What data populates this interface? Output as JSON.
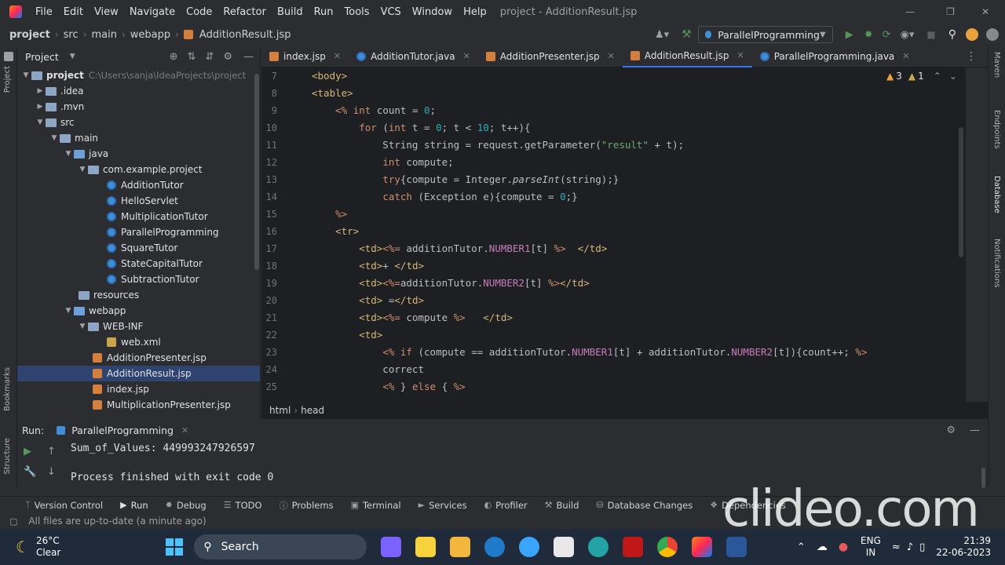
{
  "menu": {
    "items": [
      "File",
      "Edit",
      "View",
      "Navigate",
      "Code",
      "Refactor",
      "Build",
      "Run",
      "Tools",
      "VCS",
      "Window",
      "Help"
    ],
    "title": "project - AdditionResult.jsp"
  },
  "breadcrumb": [
    "project",
    "src",
    "main",
    "webapp",
    "AdditionResult.jsp"
  ],
  "run_config": "ParallelProgramming",
  "project_panel": {
    "title": "Project",
    "root": "project",
    "root_path": "C:\\Users\\sanja\\IdeaProjects\\project",
    "items": [
      {
        "label": ".idea"
      },
      {
        "label": ".mvn"
      },
      {
        "label": "src"
      },
      {
        "label": "main"
      },
      {
        "label": "java"
      },
      {
        "label": "com.example.project"
      },
      {
        "label": "AdditionTutor"
      },
      {
        "label": "HelloServlet"
      },
      {
        "label": "MultiplicationTutor"
      },
      {
        "label": "ParallelProgramming"
      },
      {
        "label": "SquareTutor"
      },
      {
        "label": "StateCapitalTutor"
      },
      {
        "label": "SubtractionTutor"
      },
      {
        "label": "resources"
      },
      {
        "label": "webapp"
      },
      {
        "label": "WEB-INF"
      },
      {
        "label": "web.xml"
      },
      {
        "label": "AdditionPresenter.jsp"
      },
      {
        "label": "AdditionResult.jsp"
      },
      {
        "label": "index.jsp"
      },
      {
        "label": "MultiplicationPresenter.jsp"
      }
    ]
  },
  "tabs": [
    {
      "label": "index.jsp"
    },
    {
      "label": "AdditionTutor.java"
    },
    {
      "label": "AdditionPresenter.jsp"
    },
    {
      "label": "AdditionResult.jsp"
    },
    {
      "label": "ParallelProgramming.java"
    }
  ],
  "inspections": {
    "warnings": "3",
    "weak": "1"
  },
  "editor": {
    "line_numbers": [
      "7",
      "8",
      "9",
      "10",
      "11",
      "12",
      "13",
      "14",
      "15",
      "16",
      "17",
      "18",
      "19",
      "20",
      "21",
      "22",
      "23",
      "24",
      "25"
    ]
  },
  "editor_breadcrumb": [
    "html",
    "head"
  ],
  "run_panel": {
    "label": "Run:",
    "config": "ParallelProgramming",
    "output_line1": "Sum_of_Values: 449993247926597",
    "output_line2": "Process finished with exit code 0"
  },
  "tool_windows": [
    "Version Control",
    "Run",
    "Debug",
    "TODO",
    "Problems",
    "Terminal",
    "Services",
    "Profiler",
    "Build",
    "Database Changes",
    "Dependencies"
  ],
  "status": {
    "message": "All files are up-to-date (a minute ago)"
  },
  "right_strip": [
    "Maven",
    "Endpoints",
    "Database",
    "Notifications"
  ],
  "left_strip": [
    "Project",
    "Bookmarks",
    "Structure"
  ],
  "taskbar": {
    "weather_temp": "26°C",
    "weather_desc": "Clear",
    "search": "Search",
    "lang1": "ENG",
    "lang2": "IN",
    "time": "21:39",
    "date": "22-06-2023"
  },
  "watermark": "clideo.com"
}
